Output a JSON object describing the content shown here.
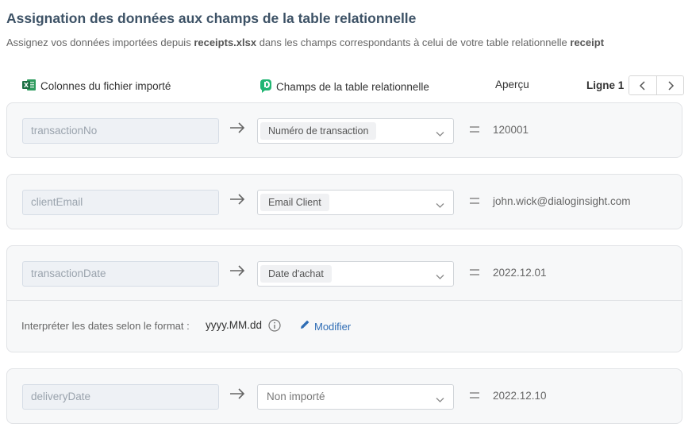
{
  "header": {
    "title": "Assignation des données aux champs de la table relationnelle",
    "subtitle_before": "Assignez vos données importées depuis ",
    "subtitle_file": "receipts.xlsx",
    "subtitle_middle": " dans les champs correspondants à celui de votre table relationnelle ",
    "subtitle_table": "receipt"
  },
  "columns": {
    "source": "Colonnes du fichier importé",
    "destination": "Champs de la table relationnelle",
    "preview": "Aperçu"
  },
  "pager": {
    "label": "Ligne 1"
  },
  "mappings": [
    {
      "source": "transactionNo",
      "target": "Numéro de transaction",
      "preview": "120001"
    },
    {
      "source": "clientEmail",
      "target": "Email Client",
      "preview": "john.wick@dialoginsight.com"
    },
    {
      "source": "transactionDate",
      "target": "Date d'achat",
      "preview": "2022.12.01"
    },
    {
      "source": "deliveryDate",
      "target": "Non importé",
      "preview": "2022.12.10"
    }
  ],
  "date_format": {
    "label": "Interpréter les dates selon le format :",
    "value": "yyyy.MM.dd",
    "modify_label": "Modifier"
  },
  "colors": {
    "title": "#3d5266",
    "excel_green": "#1d7044",
    "brand_green": "#21b573",
    "link_blue": "#2f6db5"
  },
  "icons": {
    "excel": "excel-icon",
    "brand": "dialog-insight-icon",
    "arrow": "arrow-right-icon",
    "chevron": "chevron-down-icon",
    "info": "info-icon",
    "edit": "pencil-icon"
  }
}
